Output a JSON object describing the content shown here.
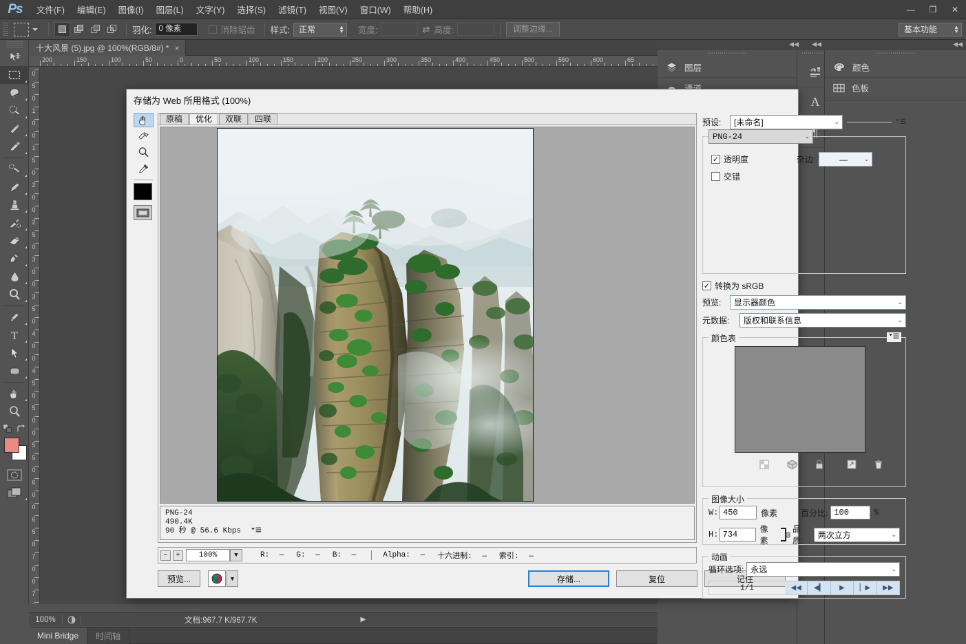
{
  "app": {
    "logo": "Ps",
    "menus": [
      "文件(F)",
      "编辑(E)",
      "图像(I)",
      "图层(L)",
      "文字(Y)",
      "选择(S)",
      "滤镜(T)",
      "视图(V)",
      "窗口(W)",
      "帮助(H)"
    ],
    "window_buttons": [
      "—",
      "❐",
      "✕"
    ]
  },
  "options_bar": {
    "feather_label": "羽化:",
    "feather_value": "0 像素",
    "antialias_label": "消除锯齿",
    "style_label": "样式:",
    "style_value": "正常",
    "width_label": "宽度:",
    "width_value": "",
    "height_label": "高度:",
    "height_value": "",
    "refine_edge": "调整边缘...",
    "workspace": "基本功能"
  },
  "document": {
    "tab_title": "十大风景 (5).jpg @ 100%(RGB/8#) *",
    "close_glyph": "×",
    "ruler_h_ticks": [
      "200",
      "150",
      "100",
      "50",
      "0",
      "50",
      "100",
      "150",
      "200",
      "250",
      "300",
      "350",
      "400",
      "450",
      "500",
      "550",
      "600",
      "65"
    ],
    "ruler_v_ticks": [
      "0",
      "5",
      "0",
      "1",
      "0",
      "0",
      "1",
      "5",
      "0",
      "2",
      "0",
      "0",
      "2",
      "5",
      "0",
      "3",
      "0",
      "0",
      "3",
      "5",
      "0",
      "4",
      "0",
      "0",
      "4",
      "5",
      "0",
      "5",
      "0",
      "0",
      "5",
      "5",
      "0",
      "6",
      "0",
      "0",
      "6",
      "5",
      "0",
      "7",
      "0",
      "0",
      "7",
      "5"
    ]
  },
  "status_bar": {
    "zoom": "100%",
    "doc_label": "文档:967.7 K/967.7K",
    "arrow": "▶"
  },
  "bottom_tabs": {
    "mini_bridge": "Mini Bridge",
    "timeline": "时间轴"
  },
  "right_dock": {
    "collapse_glyph": "◀◀",
    "panels_group_a": [
      {
        "label": "图层",
        "icon": "layers-icon"
      },
      {
        "label": "通道",
        "icon": "channels-icon"
      }
    ],
    "icon_column": [
      {
        "icon": "adjustments-icon"
      },
      {
        "icon": "character-icon",
        "glyph": "A"
      },
      {
        "icon": "paragraph-icon",
        "glyph": "¶"
      }
    ],
    "panels_group_b": [
      {
        "label": "颜色",
        "icon": "color-palette-icon"
      },
      {
        "label": "色板",
        "icon": "swatches-icon"
      }
    ]
  },
  "toolbar": {
    "tools": [
      {
        "name": "move-tool"
      },
      {
        "name": "rectangular-marquee-tool",
        "active": true
      },
      {
        "name": "lasso-tool"
      },
      {
        "name": "quick-selection-tool"
      },
      {
        "name": "crop-tool"
      },
      {
        "name": "eyedropper-tool"
      },
      {
        "name": "healing-brush-tool"
      },
      {
        "name": "brush-tool"
      },
      {
        "name": "clone-stamp-tool"
      },
      {
        "name": "history-brush-tool"
      },
      {
        "name": "eraser-tool"
      },
      {
        "name": "gradient-tool"
      },
      {
        "name": "blur-tool"
      },
      {
        "name": "dodge-tool"
      },
      {
        "name": "pen-tool"
      },
      {
        "name": "type-tool"
      },
      {
        "name": "path-selection-tool"
      },
      {
        "name": "rounded-rectangle-tool"
      },
      {
        "name": "hand-tool"
      },
      {
        "name": "zoom-tool"
      }
    ],
    "foreground_color": "#e98b84",
    "background_color": "#ffffff"
  },
  "save_for_web": {
    "title": "存储为 Web 所用格式 (100%)",
    "tools": [
      {
        "name": "hand-tool",
        "selected": true
      },
      {
        "name": "slice-select-tool",
        "selected": false
      },
      {
        "name": "zoom-tool",
        "selected": false
      },
      {
        "name": "eyedropper-tool",
        "selected": false
      }
    ],
    "eyedropper_color": "#000000",
    "tabs": [
      {
        "label": "原稿",
        "active": false
      },
      {
        "label": "优化",
        "active": true
      },
      {
        "label": "双联",
        "active": false
      },
      {
        "label": "四联",
        "active": false
      }
    ],
    "info": {
      "format": "PNG-24",
      "size": "490.4K",
      "speed": "90 秒 @ 56.6 Kbps"
    },
    "zoom_bar": {
      "minus": "−",
      "plus": "+",
      "zoom_value": "100%",
      "r_label": "R:",
      "r_value": "—",
      "g_label": "G:",
      "g_value": "—",
      "b_label": "B:",
      "b_value": "—",
      "alpha_label": "Alpha:",
      "alpha_value": "—",
      "hex_label": "十六进制:",
      "hex_value": "—",
      "index_label": "索引:",
      "index_value": "—"
    },
    "buttons": {
      "preview": "预览...",
      "save": "存储...",
      "reset": "复位",
      "remember": "记住"
    },
    "settings": {
      "preset_label": "预设:",
      "preset_value": "[未命名]",
      "format_value": "PNG-24",
      "transparency_label": "透明度",
      "transparency_checked": true,
      "interlace_label": "交错",
      "interlace_checked": false,
      "matte_label": "杂边:",
      "matte_value": "—",
      "convert_srgb_label": "转换为 sRGB",
      "convert_srgb_checked": true,
      "preview_label": "预览:",
      "preview_value": "显示器颜色",
      "metadata_label": "元数据:",
      "metadata_value": "版权和联系信息",
      "color_table_label": "颜色表",
      "color_table_icons": [
        "transparency-icon",
        "web-shift-icon",
        "lock-icon",
        "new-color-icon",
        "trash-icon"
      ]
    },
    "image_size": {
      "group_label": "图像大小",
      "w_label": "W:",
      "w_value": "450",
      "w_unit": "像素",
      "h_label": "H:",
      "h_value": "734",
      "h_unit": "像素",
      "link_icon": "link-icon",
      "percent_label": "百分比:",
      "percent_value": "100",
      "percent_unit": "%",
      "quality_label": "品质:",
      "quality_value": "两次立方"
    },
    "animation": {
      "group_label": "动画",
      "loop_label": "循环选项:",
      "loop_value": "永远",
      "frame_counter": "1/1",
      "controls": [
        "first-frame-button",
        "prev-frame-button",
        "play-button",
        "next-frame-button",
        "last-frame-button"
      ]
    }
  }
}
